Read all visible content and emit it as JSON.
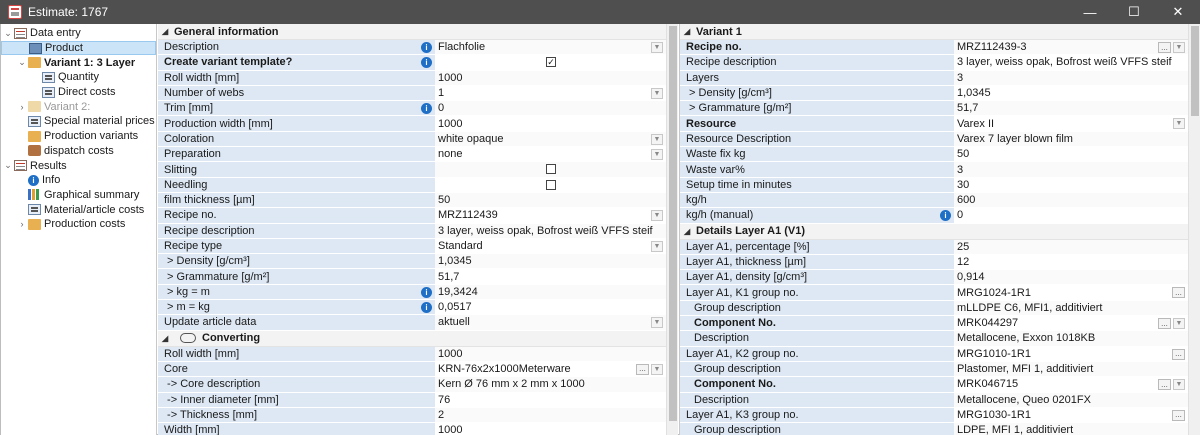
{
  "window": {
    "title": "Estimate: 1767",
    "minimize": "—",
    "maximize": "☐",
    "close": "✕"
  },
  "tree": [
    {
      "label": "Data entry",
      "icon": "doc",
      "level": 0,
      "exp": "⌄"
    },
    {
      "label": "Product",
      "icon": "prod",
      "level": 1,
      "selected": true
    },
    {
      "label": "Variant 1: 3 Layer",
      "icon": "folder",
      "level": 1,
      "exp": "⌄",
      "bold": true
    },
    {
      "label": "Quantity",
      "icon": "calc",
      "level": 2
    },
    {
      "label": "Direct costs",
      "icon": "calc",
      "level": 2
    },
    {
      "label": "Variant 2:",
      "icon": "folder",
      "level": 1,
      "exp": "›",
      "dim": true
    },
    {
      "label": "Special material prices",
      "icon": "calc",
      "level": 1
    },
    {
      "label": "Production variants",
      "icon": "folder",
      "level": 1
    },
    {
      "label": "dispatch costs",
      "icon": "truck",
      "level": 1
    },
    {
      "label": "Results",
      "icon": "doc",
      "level": 0,
      "exp": "⌄"
    },
    {
      "label": "Info",
      "icon": "info",
      "level": 1
    },
    {
      "label": "Graphical summary",
      "icon": "chart",
      "level": 1
    },
    {
      "label": "Material/article costs",
      "icon": "calc",
      "level": 1
    },
    {
      "label": "Production costs",
      "icon": "folder",
      "level": 1,
      "exp": "›"
    }
  ],
  "left": {
    "general_header": "General information",
    "general": [
      {
        "label": "Description",
        "value": "Flachfolie",
        "info": true,
        "dd": true
      },
      {
        "label": "Create variant template?",
        "bold": true,
        "info": true,
        "checkbox": "✓"
      },
      {
        "label": "Roll width [mm]",
        "value": "1000"
      },
      {
        "label": "Number of webs",
        "value": "1",
        "dd": true
      },
      {
        "label": "Trim [mm]",
        "value": "0",
        "info": true
      },
      {
        "label": "Production width [mm]",
        "value": "1000"
      },
      {
        "label": "Coloration",
        "value": "white opaque",
        "dd": true
      },
      {
        "label": "Preparation",
        "value": "none",
        "dd": true
      },
      {
        "label": "Slitting",
        "checkbox": ""
      },
      {
        "label": "Needling",
        "checkbox": ""
      },
      {
        "label": "film thickness [µm]",
        "value": "50"
      },
      {
        "label": "Recipe no.",
        "value": "MRZ112439",
        "dd": true
      },
      {
        "label": "Recipe description",
        "value": "3 layer, weiss opak, Bofrost weiß VFFS steif"
      },
      {
        "label": "Recipe type",
        "value": "Standard",
        "dd": true
      },
      {
        "label": " > Density [g/cm³]",
        "value": "1,0345"
      },
      {
        "label": " > Grammature [g/m²]",
        "value": "51,7"
      },
      {
        "label": " > kg = m",
        "value": "19,3424",
        "info": true
      },
      {
        "label": " > m = kg",
        "value": "0,0517",
        "info": true
      },
      {
        "label": "Update article data",
        "value": "aktuell",
        "dd": true
      }
    ],
    "converting_header": "Converting",
    "converting": [
      {
        "label": "Roll width [mm]",
        "value": "1000"
      },
      {
        "label": "Core",
        "value": "KRN-76x2x1000Meterware",
        "dots": "...",
        "dd": true
      },
      {
        "label": " -> Core description",
        "value": "Kern Ø 76 mm x 2 mm x 1000"
      },
      {
        "label": " -> Inner diameter [mm]",
        "value": "76"
      },
      {
        "label": " -> Thickness [mm]",
        "value": "2"
      },
      {
        "label": "Width [mm]",
        "value": "1000"
      }
    ]
  },
  "right": {
    "variant_header": "Variant 1",
    "variant": [
      {
        "label": "Recipe no.",
        "value": "MRZ112439-3",
        "bold": true,
        "dots": "...",
        "dd": true
      },
      {
        "label": "Recipe description",
        "value": "3 layer, weiss opak, Bofrost weiß VFFS steif"
      },
      {
        "label": "Layers",
        "value": "3"
      },
      {
        "label": " > Density [g/cm³]",
        "value": "1,0345"
      },
      {
        "label": " > Grammature [g/m²]",
        "value": "51,7"
      },
      {
        "label": "Resource",
        "value": "Varex II",
        "bold": true,
        "dd": true
      },
      {
        "label": "Resource Description",
        "value": "Varex 7 layer blown film"
      },
      {
        "label": "Waste fix kg",
        "value": "50"
      },
      {
        "label": "Waste var%",
        "value": "3"
      },
      {
        "label": "Setup time in minutes",
        "value": "30"
      },
      {
        "label": "kg/h",
        "value": "600"
      },
      {
        "label": "kg/h (manual)",
        "value": "0",
        "info": true
      }
    ],
    "details_header": "Details Layer A1 (V1)",
    "details": [
      {
        "label": "Layer A1, percentage [%]",
        "value": "25"
      },
      {
        "label": "Layer A1, thickness [µm]",
        "value": "12"
      },
      {
        "label": "Layer A1, density [g/cm³]",
        "value": "0,914"
      },
      {
        "label": "Layer A1, K1 group no.",
        "value": "MRG1024-1R1",
        "dotsonly": "..."
      },
      {
        "label": "Group description",
        "value": "mLLDPE C6, MFI1, additiviert",
        "indent": true
      },
      {
        "label": "Component No.",
        "value": "MRK044297",
        "indent": true,
        "bold": true,
        "dots": "...",
        "dd": true
      },
      {
        "label": "Description",
        "value": "Metallocene, Exxon 1018KB",
        "indent": true
      },
      {
        "label": "Layer A1, K2 group no.",
        "value": "MRG1010-1R1",
        "dotsonly": "..."
      },
      {
        "label": "Group description",
        "value": "Plastomer, MFI 1, additiviert",
        "indent": true
      },
      {
        "label": "Component No.",
        "value": "MRK046715",
        "indent": true,
        "bold": true,
        "dots": "...",
        "dd": true
      },
      {
        "label": "Description",
        "value": "Metallocene, Queo 0201FX",
        "indent": true
      },
      {
        "label": "Layer A1, K3 group no.",
        "value": "MRG1030-1R1",
        "dotsonly": "..."
      },
      {
        "label": "Group description",
        "value": "LDPE, MFI 1, additiviert",
        "indent": true
      }
    ]
  },
  "colors": {
    "label_bg": "#dde8f4",
    "titlebar": "#4f4f4f",
    "info_blue": "#1f6fc6",
    "selection": "#cce4f7"
  }
}
